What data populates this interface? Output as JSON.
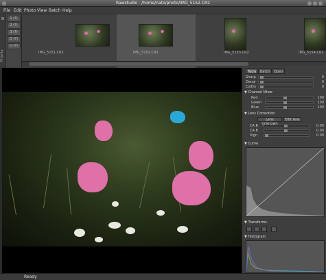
{
  "window": {
    "title": "Rawstudio - /home/nate/photo/IMG_5152.CR2"
  },
  "menu": [
    "File",
    "Edit",
    "Photo",
    "View",
    "Batch",
    "Help"
  ],
  "priority_buttons": [
    "1 (?)",
    "2 (?)",
    "3 (?)",
    "D (?)",
    "U (?)"
  ],
  "priority_label": "Priority",
  "thumbnails": [
    {
      "name": "IMG_5151.CR2",
      "selected": false
    },
    {
      "name": "IMG_5152.CR2",
      "selected": true
    },
    {
      "name": "IMG_5153.CR2",
      "selected": false
    },
    {
      "name": "IMG_5154.CR2",
      "selected": false
    }
  ],
  "tabs": [
    "Tools",
    "Batch",
    "Open"
  ],
  "sliders": [
    {
      "label": "Sharp",
      "value": "0"
    },
    {
      "label": "Denoi",
      "value": "0"
    },
    {
      "label": "ColDn",
      "value": "0"
    }
  ],
  "channel_mixer": {
    "title": "Channel Mixer",
    "rows": [
      {
        "label": "Red",
        "value": "100"
      },
      {
        "label": "Green",
        "value": "100"
      },
      {
        "label": "Blue",
        "value": "100"
      }
    ]
  },
  "lens": {
    "title": "Lens Correction",
    "btn1": "Lens Unknown",
    "btn2": "Edit lens",
    "rows": [
      {
        "label": "CA R",
        "value": "0.00"
      },
      {
        "label": "CA B",
        "value": "0.00"
      },
      {
        "label": "Vign",
        "value": "0.00"
      }
    ]
  },
  "curve": {
    "title": "Curve"
  },
  "transforms": {
    "title": "Transforms"
  },
  "histogram": {
    "title": "Histogram"
  },
  "status": {
    "text": "Ready"
  },
  "colors": {
    "accent": "#e070a8"
  }
}
